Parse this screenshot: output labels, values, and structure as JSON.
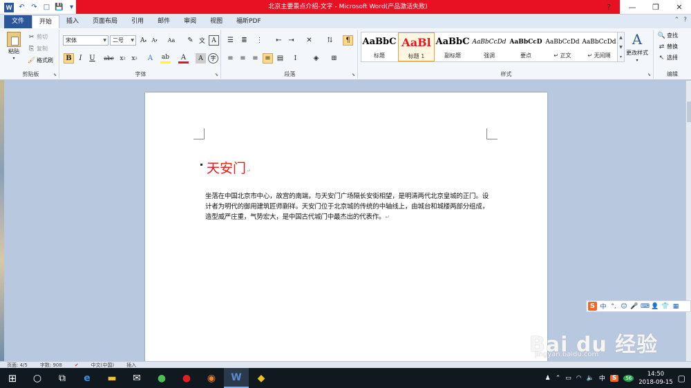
{
  "window": {
    "title": "北京主要景点介绍-文字 - Microsoft Word(产品激活失败)",
    "controls": {
      "help": "?",
      "minimize": "—",
      "restore": "❐",
      "close": "✕"
    }
  },
  "qat": {
    "logo": "W",
    "undo": "↶",
    "redo": "↷",
    "new": "□",
    "save": "💾"
  },
  "tabs": {
    "file": "文件",
    "home": "开始",
    "insert": "插入",
    "page_layout": "页面布局",
    "references": "引用",
    "mailings": "邮件",
    "review": "审阅",
    "view": "视图",
    "foxit_pdf": "福昕PDF"
  },
  "ribbon": {
    "clipboard": {
      "label": "剪贴板",
      "paste": "粘贴",
      "cut": "剪切",
      "copy": "复制",
      "format_painter": "格式刷"
    },
    "font": {
      "label": "字体",
      "font_name": "宋体",
      "font_size": "二号",
      "aa": "Aa"
    },
    "paragraph": {
      "label": "段落"
    },
    "styles": {
      "label": "样式",
      "items": [
        {
          "preview": "AaBbC",
          "name": "标题"
        },
        {
          "preview": "AaBl",
          "name": "标题 1"
        },
        {
          "preview": "AaBbC",
          "name": "副标题"
        },
        {
          "preview": "AaBbCcDd",
          "name": "强调"
        },
        {
          "preview": "AaBbCcD",
          "name": "要点"
        },
        {
          "preview": "AaBbCcDd",
          "name": "↵ 正文"
        },
        {
          "preview": "AaBbCcDd",
          "name": "↵ 无间隔"
        }
      ],
      "change_styles": "更改样式"
    },
    "editing": {
      "label": "编辑",
      "find": "查找",
      "replace": "替换",
      "select": "选择"
    }
  },
  "document": {
    "heading": "天安门",
    "paragraph": "坐落在中国北京市中心，故宫的南端，与天安门广场隔长安街相望，是明清两代北京皇城的正门。设计者为明代的御用建筑匠师蒯祥。天安门位于北京城的传统的中轴线上，由城台和城楼两部分组成，造型威严庄重，气势宏大，是中国古代城门中最杰出的代表作。"
  },
  "ime": {
    "logo": "S",
    "mode": "中"
  },
  "watermark": {
    "brand": "Bai du 经验",
    "url": "jingyan.baidu.com"
  },
  "status": {
    "page": "页面: 4/5",
    "words": "字数: 908",
    "lang": "中文(中国)",
    "insert": "插入"
  },
  "tray": {
    "ime": "中",
    "badge": "56",
    "time": "14:50",
    "date": "2018-09-15"
  },
  "colors": {
    "accent": "#2b579a",
    "title_bar": "#e81123",
    "heading": "#e8171a"
  }
}
